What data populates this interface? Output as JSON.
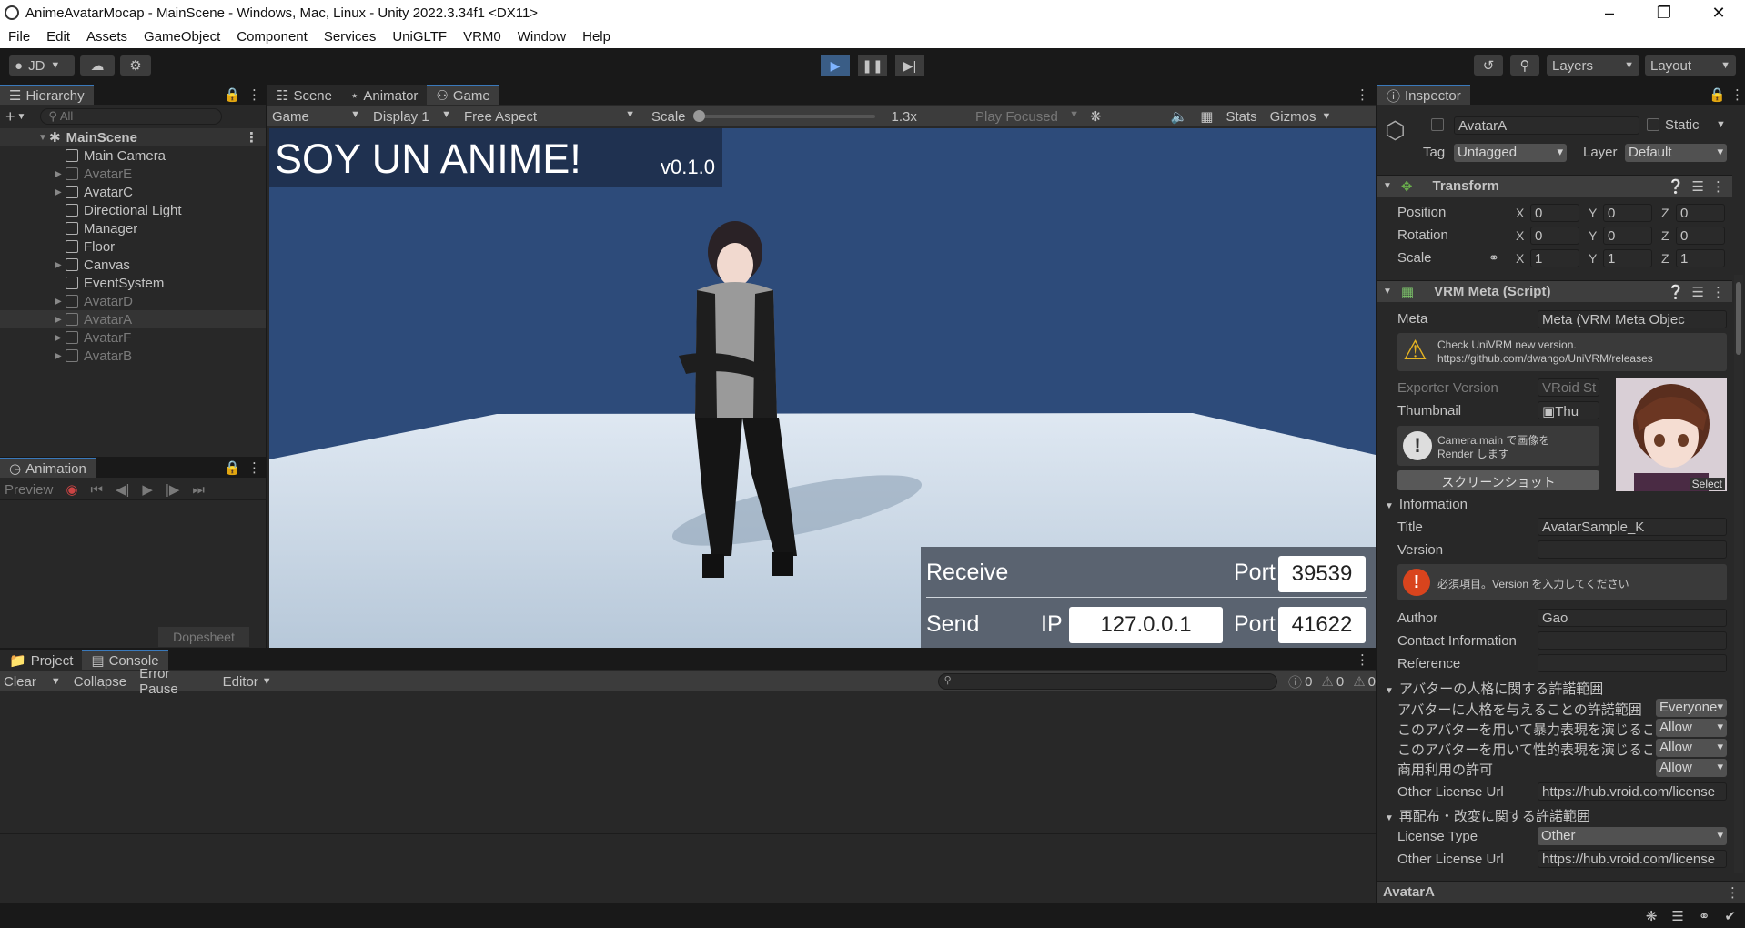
{
  "window": {
    "title": "AnimeAvatarMocap - MainScene - Windows, Mac, Linux - Unity 2022.3.34f1 <DX11>"
  },
  "menu": [
    "File",
    "Edit",
    "Assets",
    "GameObject",
    "Component",
    "Services",
    "UniGLTF",
    "VRM0",
    "Window",
    "Help"
  ],
  "toolbar": {
    "account": "JD",
    "layers": "Layers",
    "layout": "Layout"
  },
  "hierarchy": {
    "tab": "Hierarchy",
    "search_placeholder": "All",
    "scene": "MainScene",
    "items": [
      {
        "label": "Main Camera",
        "dim": false,
        "expandable": false
      },
      {
        "label": "AvatarE",
        "dim": true,
        "expandable": true
      },
      {
        "label": "AvatarC",
        "dim": false,
        "expandable": true
      },
      {
        "label": "Directional Light",
        "dim": false,
        "expandable": false
      },
      {
        "label": "Manager",
        "dim": false,
        "expandable": false
      },
      {
        "label": "Floor",
        "dim": false,
        "expandable": false
      },
      {
        "label": "Canvas",
        "dim": false,
        "expandable": true
      },
      {
        "label": "EventSystem",
        "dim": false,
        "expandable": false
      },
      {
        "label": "AvatarD",
        "dim": true,
        "expandable": true
      },
      {
        "label": "AvatarA",
        "dim": true,
        "expandable": true
      },
      {
        "label": "AvatarF",
        "dim": true,
        "expandable": true
      },
      {
        "label": "AvatarB",
        "dim": true,
        "expandable": true
      }
    ]
  },
  "animation": {
    "tab": "Animation",
    "preview": "Preview",
    "dopesheet": "Dopesheet"
  },
  "center_tabs": {
    "scene": "Scene",
    "animator": "Animator",
    "game": "Game"
  },
  "game_toolbar": {
    "mode": "Game",
    "display": "Display 1",
    "aspect": "Free Aspect",
    "scale_label": "Scale",
    "scale_value": "1.3x",
    "play_focused": "Play Focused",
    "stats": "Stats",
    "gizmos": "Gizmos"
  },
  "game_ui": {
    "title": "SOY UN ANIME!",
    "version": "v0.1.0",
    "receive": "Receive",
    "send": "Send",
    "port_label": "Port",
    "ip_label": "IP",
    "receive_port": "39539",
    "send_ip": "127.0.0.1",
    "send_port": "41622"
  },
  "bottom_tabs": {
    "project": "Project",
    "console": "Console"
  },
  "console": {
    "clear": "Clear",
    "collapse": "Collapse",
    "error_pause": "Error Pause",
    "editor": "Editor",
    "count_log": "0",
    "count_warn": "0",
    "count_error": "0"
  },
  "inspector": {
    "tab": "Inspector",
    "object_name": "AvatarA",
    "static": "Static",
    "tag_label": "Tag",
    "tag_value": "Untagged",
    "layer_label": "Layer",
    "layer_value": "Default",
    "transform": {
      "title": "Transform",
      "position_label": "Position",
      "rotation_label": "Rotation",
      "scale_label": "Scale",
      "position": [
        "0",
        "0",
        "0"
      ],
      "rotation": [
        "0",
        "0",
        "0"
      ],
      "scale": [
        "1",
        "1",
        "1"
      ]
    },
    "vrm_meta": {
      "title": "VRM Meta (Script)",
      "meta_label": "Meta",
      "meta_value": "Meta (VRM Meta Objec",
      "check_line1": "Check UniVRM new version.",
      "check_line2": "https://github.com/dwango/UniVRM/releases",
      "exporter_label": "Exporter Version",
      "exporter_value": "VRoid St",
      "thumbnail_label": "Thumbnail",
      "thumbnail_value": "Thu",
      "camera_line1": "Camera.main で画像を",
      "camera_line2": "Render します",
      "screenshot_button": "スクリーンショット",
      "select": "Select"
    },
    "information": {
      "header": "Information",
      "title_label": "Title",
      "title_value": "AvatarSample_K",
      "version_label": "Version",
      "version_value": "",
      "required_msg": "必須項目。Version を入力してください",
      "author_label": "Author",
      "author_value": "Gao",
      "contact_label": "Contact Information",
      "reference_label": "Reference"
    },
    "permission": {
      "header": "アバターの人格に関する許諾範囲",
      "rows": [
        {
          "label": "アバターに人格を与えることの許諾範囲",
          "value": "Everyone"
        },
        {
          "label": "このアバターを用いて暴力表現を演じるこ",
          "value": "Allow"
        },
        {
          "label": "このアバターを用いて性的表現を演じるこ",
          "value": "Allow"
        },
        {
          "label": "商用利用の許可",
          "value": "Allow"
        }
      ],
      "other_license_label": "Other License Url",
      "other_license_value": "https://hub.vroid.com/license"
    },
    "redistribution": {
      "header": "再配布・改変に関する許諾範囲",
      "license_type_label": "License Type",
      "license_type_value": "Other",
      "other_license_label": "Other License Url",
      "other_license_value": "https://hub.vroid.com/license"
    },
    "footer": "AvatarA"
  }
}
